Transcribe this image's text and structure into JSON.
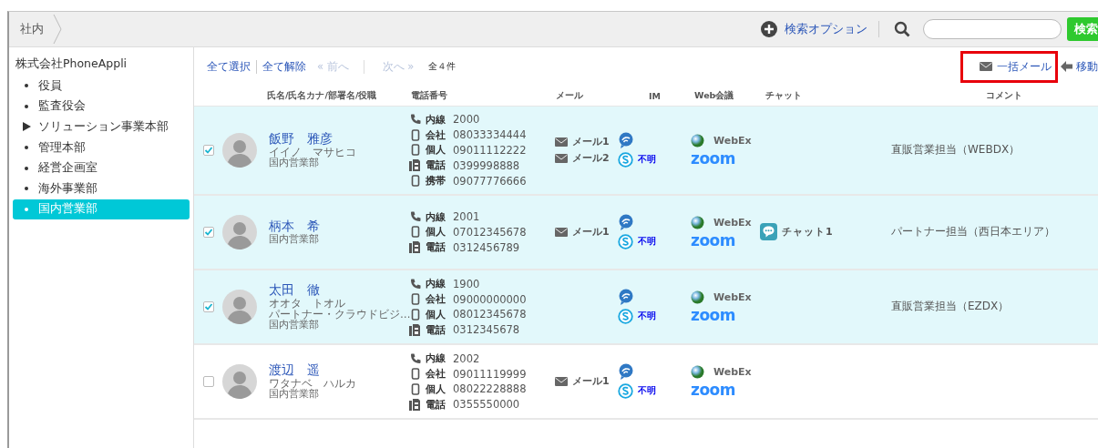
{
  "breadcrumb": [
    {
      "label": "社内"
    }
  ],
  "search": {
    "option_label": "検索オプション",
    "button": "検索"
  },
  "sidebar": {
    "root": "株式会社PhoneAppli",
    "items": [
      {
        "label": "役員",
        "has_children": false,
        "selected": false
      },
      {
        "label": "監査役会",
        "has_children": false,
        "selected": false
      },
      {
        "label": "ソリューション事業本部",
        "has_children": true,
        "selected": false
      },
      {
        "label": "管理本部",
        "has_children": false,
        "selected": false
      },
      {
        "label": "経営企画室",
        "has_children": false,
        "selected": false
      },
      {
        "label": "海外事業部",
        "has_children": false,
        "selected": false
      },
      {
        "label": "国内営業部",
        "has_children": false,
        "selected": true
      }
    ]
  },
  "toolbar": {
    "select_all": "全て選択",
    "deselect_all": "全て解除",
    "prev": {
      "label": "« 前へ",
      "disabled": true
    },
    "next": {
      "label": "次へ »",
      "disabled": true
    },
    "count": "全４件",
    "bulk_mail": {
      "label": "一括メール",
      "highlighted": true
    },
    "move": "移動"
  },
  "table": {
    "columns": [
      "氏名/氏名カナ/部署名/役職",
      "電話番号",
      "メール",
      "IM",
      "Web会議",
      "チャット",
      "コメント"
    ],
    "rows": [
      {
        "checked": true,
        "name": "飯野　雅彦",
        "kana": "イイノ　マサヒコ",
        "dept": "国内営業部",
        "phones": [
          {
            "kind": "ext",
            "label": "内線",
            "number": "2000"
          },
          {
            "kind": "mobile",
            "label": "会社",
            "number": "08033334444"
          },
          {
            "kind": "mobile",
            "label": "個人",
            "number": "09011112222"
          },
          {
            "kind": "fax",
            "label": "電話",
            "number": "0399998888"
          },
          {
            "kind": "mobile",
            "label": "携帯",
            "number": "09077776666"
          }
        ],
        "mails": [
          "メール1",
          "メール2"
        ],
        "im_status": "不明",
        "webconf": [
          {
            "kind": "webex",
            "label": "WebEx"
          },
          {
            "kind": "zoom",
            "label": "zoom"
          }
        ],
        "chats": [],
        "comment": "直販営業担当（WEBDX）"
      },
      {
        "checked": true,
        "name": "柄本　希",
        "dept": "国内営業部",
        "phones": [
          {
            "kind": "ext",
            "label": "内線",
            "number": "2001"
          },
          {
            "kind": "mobile",
            "label": "個人",
            "number": "07012345678"
          },
          {
            "kind": "fax",
            "label": "電話",
            "number": "0312456789"
          }
        ],
        "mails": [
          "メール1"
        ],
        "im_status": "不明",
        "webconf": [
          {
            "kind": "webex",
            "label": "WebEx"
          },
          {
            "kind": "zoom",
            "label": "zoom"
          }
        ],
        "chats": [
          "チャット1"
        ],
        "comment": "パートナー担当（西日本エリア）"
      },
      {
        "checked": true,
        "name": "太田　徹",
        "kana": "オオタ　トオル",
        "title": "パートナー・クラウドビジ…",
        "dept": "国内営業部",
        "phones": [
          {
            "kind": "ext",
            "label": "内線",
            "number": "1900"
          },
          {
            "kind": "mobile",
            "label": "会社",
            "number": "09000000000"
          },
          {
            "kind": "mobile",
            "label": "個人",
            "number": "08012345678"
          },
          {
            "kind": "fax",
            "label": "電話",
            "number": "0312345678"
          }
        ],
        "mails": [],
        "im_status": "不明",
        "webconf": [
          {
            "kind": "webex",
            "label": "WebEx"
          },
          {
            "kind": "zoom",
            "label": "zoom"
          }
        ],
        "chats": [],
        "comment": "直販営業担当（EZDX）"
      },
      {
        "checked": false,
        "name": "渡辺　遥",
        "kana": "ワタナベ　ハルカ",
        "dept": "国内営業部",
        "phones": [
          {
            "kind": "ext",
            "label": "内線",
            "number": "2002"
          },
          {
            "kind": "mobile",
            "label": "会社",
            "number": "09011119999"
          },
          {
            "kind": "mobile",
            "label": "個人",
            "number": "08022228888"
          },
          {
            "kind": "fax",
            "label": "電話",
            "number": "0355550000"
          }
        ],
        "mails": [
          "メール1"
        ],
        "im_status": "不明",
        "webconf": [
          {
            "kind": "webex",
            "label": "WebEx"
          },
          {
            "kind": "zoom",
            "label": "zoom"
          }
        ],
        "chats": [],
        "comment": ""
      }
    ]
  }
}
